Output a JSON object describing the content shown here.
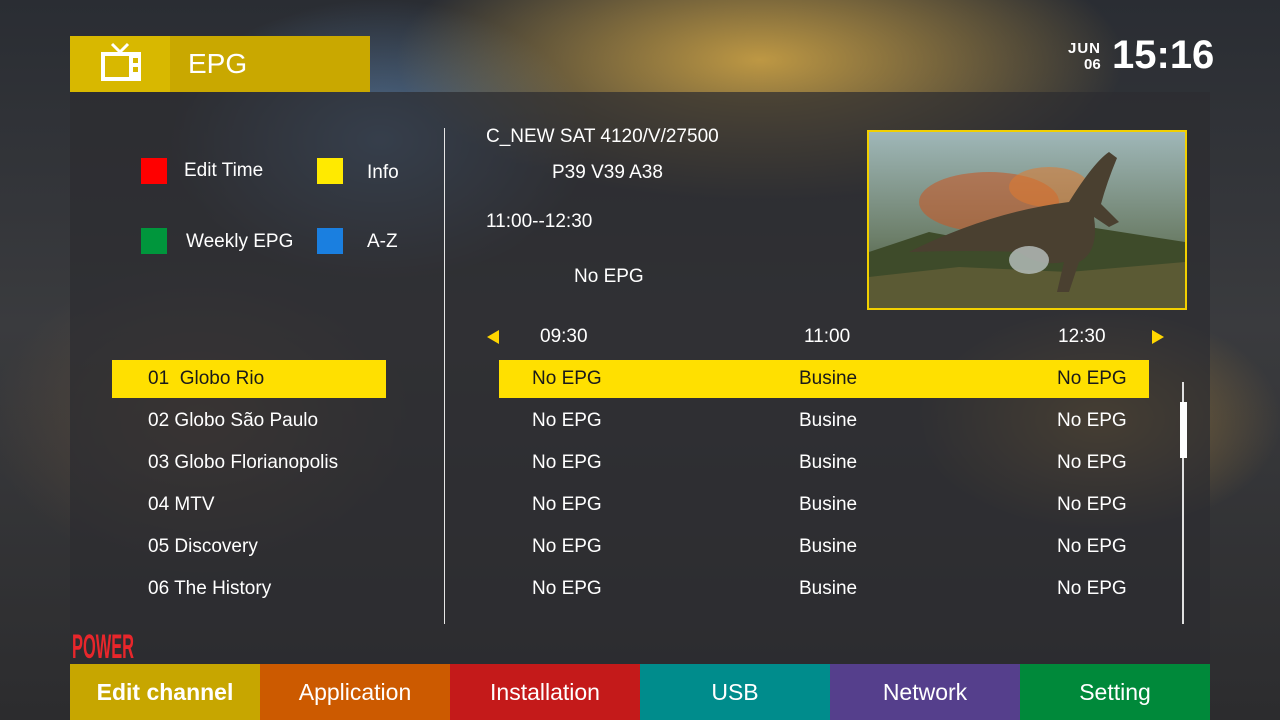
{
  "header": {
    "title": "EPG",
    "icon": "tv-icon",
    "date_month": "JUN",
    "date_day": "06",
    "time": "15:16"
  },
  "legend": [
    {
      "color": "#ff0000",
      "label": "Edit Time"
    },
    {
      "color": "#ffea00",
      "label": "Info"
    },
    {
      "color": "#00963c",
      "label": "Weekly EPG"
    },
    {
      "color": "#1a7fe0",
      "label": "A-Z"
    }
  ],
  "channels": [
    {
      "label": "01  Globo Rio",
      "selected": true
    },
    {
      "label": "02 Globo São Paulo",
      "selected": false
    },
    {
      "label": "03 Globo Florianopolis",
      "selected": false
    },
    {
      "label": "04 MTV",
      "selected": false
    },
    {
      "label": "05 Discovery",
      "selected": false
    },
    {
      "label": "06 The History",
      "selected": false
    }
  ],
  "info": {
    "transponder": "C_NEW SAT 4120/V/27500",
    "pids": "P39 V39 A38",
    "time_range": "11:00--12:30",
    "program": "No EPG"
  },
  "timeline": [
    "09:30",
    "11:00",
    "12:30"
  ],
  "epg_rows": [
    [
      "No EPG",
      "Busine",
      "No EPG"
    ],
    [
      "No EPG",
      "Busine",
      "No EPG"
    ],
    [
      "No EPG",
      "Busine",
      "No EPG"
    ],
    [
      "No EPG",
      "Busine",
      "No EPG"
    ],
    [
      "No EPG",
      "Busine",
      "No EPG"
    ],
    [
      "No EPG",
      "Busine",
      "No EPG"
    ]
  ],
  "logo_text": "POWER",
  "menu": [
    {
      "label": "Edit channel",
      "color": "#c7a600",
      "active": true
    },
    {
      "label": "Application",
      "color": "#cc5a00",
      "active": false
    },
    {
      "label": "Installation",
      "color": "#c41a1a",
      "active": false
    },
    {
      "label": "USB",
      "color": "#008c8c",
      "active": false
    },
    {
      "label": "Network",
      "color": "#553f8c",
      "active": false
    },
    {
      "label": "Setting",
      "color": "#00893a",
      "active": false
    }
  ],
  "colors": {
    "accent_yellow": "#ffe000",
    "header_gold": "#c9a800"
  }
}
